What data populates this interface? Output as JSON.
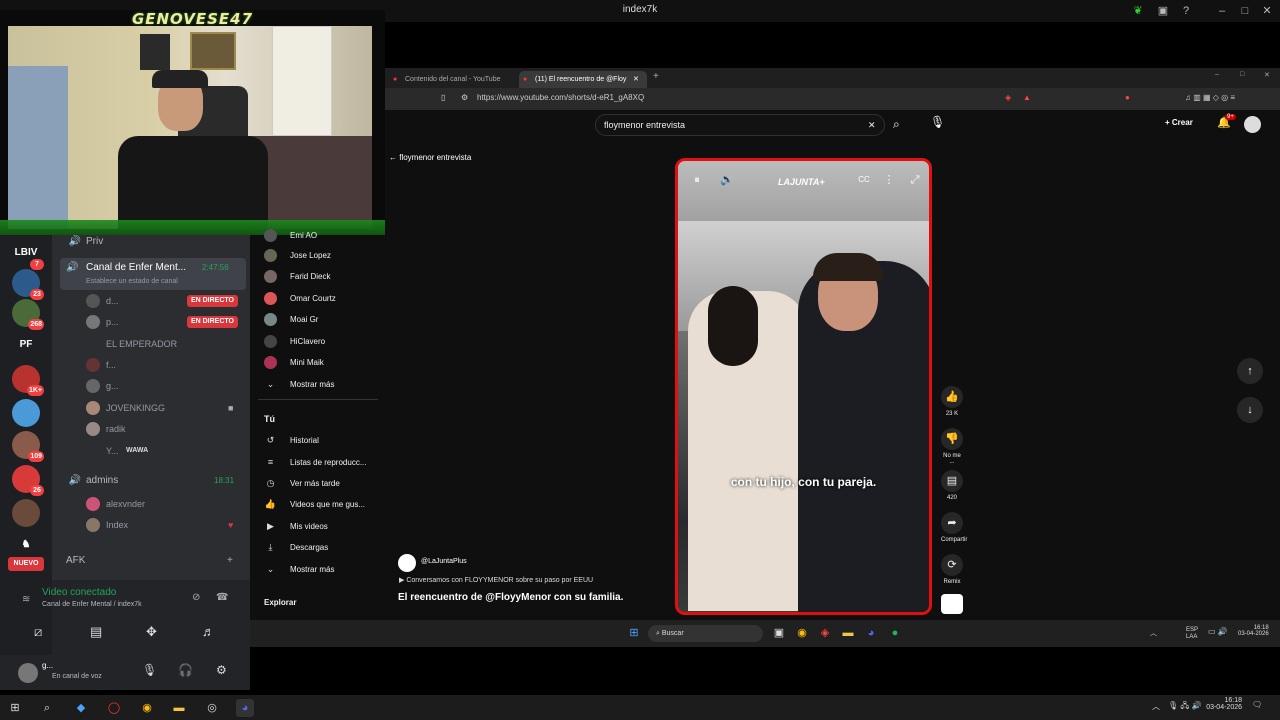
{
  "window": {
    "title": "index7k"
  },
  "stream": {
    "streamer_name": "GENOVESE47"
  },
  "discord": {
    "servers": [
      {
        "label": "LBIV",
        "badge": "7",
        "color": "#3a3d44"
      },
      {
        "label": "",
        "badge": "23",
        "color": "#2c5a8a"
      },
      {
        "label": "",
        "badge": "268",
        "color": "#4a6a3a"
      },
      {
        "label": "PF",
        "badge": "",
        "color": "#1e1f22"
      },
      {
        "label": "",
        "badge": "1K+",
        "color": "#b8322f"
      },
      {
        "label": "",
        "badge": "",
        "color": "#4a9ad8"
      },
      {
        "label": "",
        "badge": "109",
        "color": "#8a5a4a"
      },
      {
        "label": "",
        "badge": "26",
        "color": "#d83a3a"
      },
      {
        "label": "",
        "badge": "",
        "color": "#6a4a3a"
      },
      {
        "label": "",
        "badge": "",
        "color": "#1e1f22"
      },
      {
        "label": "NUEVO",
        "badge": "",
        "color": "#da373c"
      }
    ],
    "category_priv": "Priv",
    "active_channel": {
      "name": "Canal de Enfer Ment...",
      "time": "2:47:56",
      "status": "Establece un estado de canal"
    },
    "voice_users": [
      {
        "name": "d...",
        "live": "EN DIRECTO"
      },
      {
        "name": "p...",
        "live": "EN DIRECTO"
      },
      {
        "name": "EL EMPERADOR",
        "live": ""
      },
      {
        "name": "f...",
        "live": ""
      },
      {
        "name": "g...",
        "live": ""
      },
      {
        "name": "JOVENKINGG",
        "live": ""
      },
      {
        "name": "radik",
        "live": ""
      },
      {
        "name": "Y...",
        "live": "WAWA"
      }
    ],
    "admins_channel": {
      "name": "admins",
      "time": "18:31"
    },
    "admin_users": [
      "alexvnder",
      "Index"
    ],
    "afk_label": "AFK",
    "voice_status": {
      "title": "Video conectado",
      "subtitle": "Canal de Enfer Mental / index7k"
    },
    "user": {
      "name": "g...",
      "status": "En canal de voz"
    }
  },
  "youtube": {
    "tabs": [
      "Contenido del canal - YouTube Studio",
      "(11) El reencuentro de @Floy"
    ],
    "url": "https://www.youtube.com/shorts/d-eR1_gA8XQ",
    "search_value": "floymenor entrevista",
    "create_label": "Crear",
    "notif_badge": "9+",
    "back_label": "floymenor entrevista",
    "subscriptions": [
      "Emi AO",
      "Jose Lopez",
      "Farid Dieck",
      "Omar Courtz",
      "Moai Gr",
      "HiClavero",
      "Mini Maik"
    ],
    "show_more": "Mostrar más",
    "you_header": "Tú",
    "you_items": [
      "Historial",
      "Listas de reproducc...",
      "Ver más tarde",
      "Videos que me gus...",
      "Mis videos",
      "Descargas",
      "Mostrar más"
    ],
    "explore_header": "Explorar",
    "video": {
      "channel": "@LaJuntaPlus",
      "playlist": "Conversamos con FLOYYMENOR sobre su paso por EEUU",
      "title": "El reencuentro de @FloyyMenor con su familia.",
      "caption": "con tu hijo, con tu pareja.",
      "watermark": "LAJUNTA+"
    },
    "actions": [
      {
        "icon": "like-icon",
        "label": "23 K"
      },
      {
        "icon": "dislike-icon",
        "label": "No me ..."
      },
      {
        "icon": "comment-icon",
        "label": "420"
      },
      {
        "icon": "share-icon",
        "label": "Compartir"
      },
      {
        "icon": "remix-icon",
        "label": "Remix"
      }
    ]
  },
  "inner_taskbar": {
    "search": "Buscar",
    "lang": "ESP\nLAA",
    "time": "16:18",
    "date": "03-04-2026"
  },
  "taskbar": {
    "time": "16:18",
    "date": "03-04-2026"
  }
}
